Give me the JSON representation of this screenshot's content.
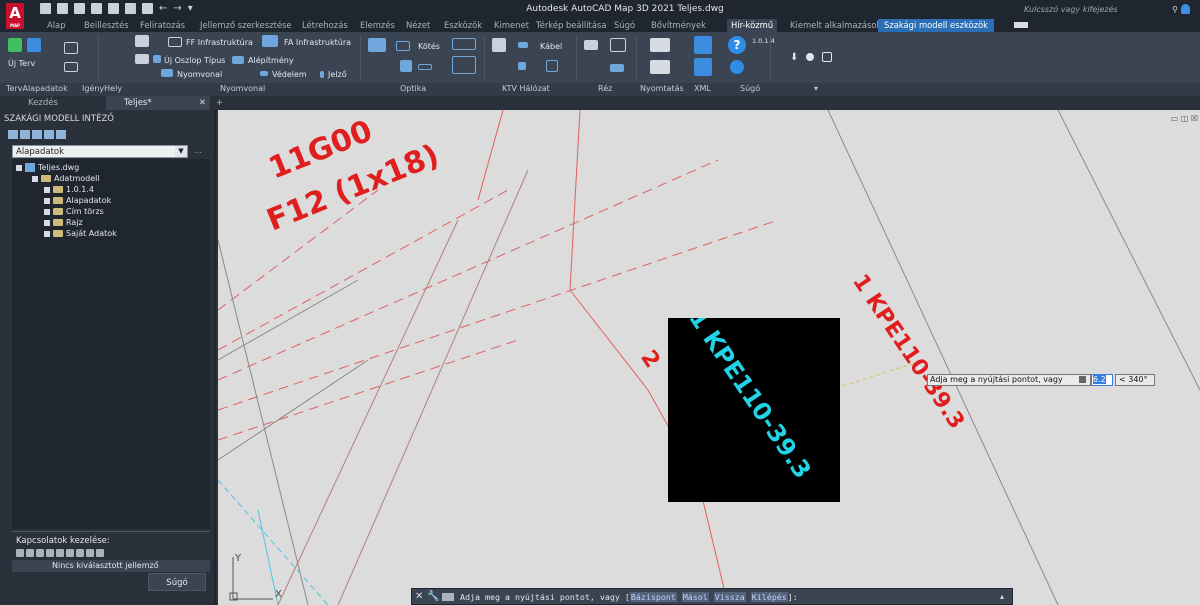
{
  "titlebar": {
    "app_letter": "A",
    "app_sub": "MAP",
    "title": "Autodesk AutoCAD Map 3D 2021   Teljes.dwg",
    "search_placeholder": "Kulcsszó vagy kifejezés"
  },
  "menu": {
    "tabs": [
      "Alap",
      "Beillesztés",
      "Feliratozás",
      "Jellemző szerkesztése",
      "Létrehozás",
      "Elemzés",
      "Nézet",
      "Eszközök",
      "Kimenet",
      "Térkép beállítása",
      "Súgó",
      "Bővítmények",
      "Hír-közmű",
      "Kiemelt alkalmazások",
      "Szakági modell eszközök"
    ],
    "active": "Hír-közmű",
    "highlighted": "Szakági modell eszközök"
  },
  "ribbon": {
    "buttons": {
      "uj_terv": "Új Terv",
      "ff_infra": "FF Infrastruktúra",
      "fa_infra": "FA Infrastruktúra",
      "uj_oszlop": "Új Oszlop Típus",
      "alepitmeny": "Alépítmény",
      "nyomvonal": "Nyomvonal",
      "vedelem": "Védelem",
      "jelzo": "Jelző",
      "kotes": "Kötés",
      "kabel": "Kábel",
      "version": "1.0.1.4"
    },
    "panels": [
      "TervAlapadatok",
      "IgényHely",
      "Nyomvonal",
      "Optika",
      "KTV Hálózat",
      "Réz",
      "Nyomtatás",
      "XML",
      "Súgó"
    ]
  },
  "doctabs": {
    "start": "Kezdés",
    "active": "Teljes*"
  },
  "left_panel": {
    "title": "SZAKÁGI MODELL INTÉZŐ",
    "dropdown_value": "Alapadatok",
    "tree": {
      "root": "Teljes.dwg",
      "child": "Adatmodell",
      "items": [
        "1.0.1.4",
        "Alapadatok",
        "Cím törzs",
        "Rajz",
        "Saját Adatok"
      ]
    },
    "relations_label": "Kapcsolatok kezelése:",
    "status": "Nincs kiválasztott jellemző",
    "help_button": "Súgó"
  },
  "canvas": {
    "labels": {
      "top_label_1": "11G00",
      "top_label_2": "F12 (1x18)",
      "right_label": "1 KPE110-39.3",
      "preview_label": "1 KPE110-39.3",
      "partial_label": "2"
    },
    "prompt": "Adja meg a nyújtási pontot, vagy",
    "input_value": "6.2",
    "angle_value": "< 340°",
    "ucs_x": "X",
    "ucs_y": "Y",
    "colors": {
      "background": "#dcdcdc",
      "red": "#e01e1e",
      "cyan": "#22d3e6"
    }
  },
  "command": {
    "prefix": "Adja meg a nyújtási pontot, vagy [",
    "options": [
      "Bázispont",
      "Másol",
      "Vissza",
      "Kilépés"
    ],
    "suffix": "]:"
  }
}
